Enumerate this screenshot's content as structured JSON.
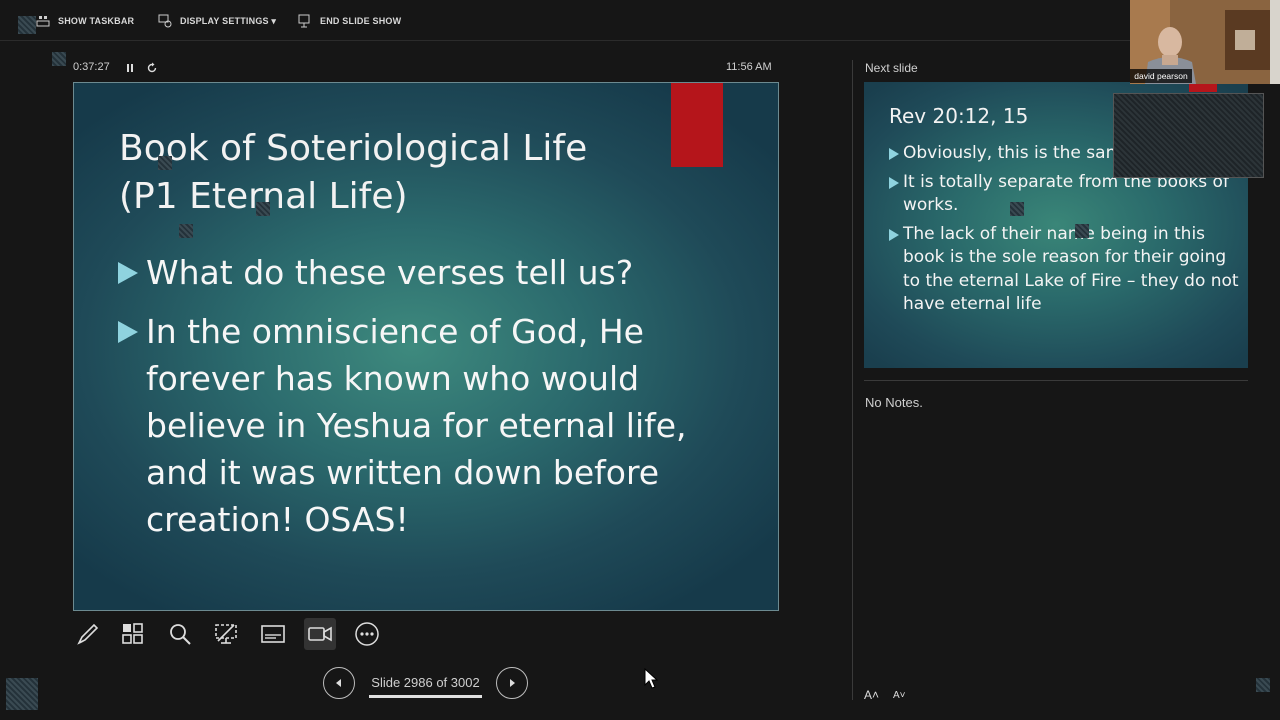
{
  "toolbar": {
    "show_taskbar": "SHOW TASKBAR",
    "display_settings": "DISPLAY SETTINGS ▾",
    "end_slide_show": "END SLIDE SHOW"
  },
  "timer": {
    "elapsed": "0:37:27",
    "clock": "11:56 AM"
  },
  "current_slide": {
    "title_line1": "Book of Soteriological Life",
    "title_line2": "(P1 Eternal Life)",
    "bullets": [
      "What do these verses tell us?",
      "In the omniscience of God, He forever has known who would believe in Yeshua for eternal life, and it was written down before creation! OSAS!"
    ]
  },
  "navigation": {
    "counter": "Slide 2986 of 3002",
    "current": 2986,
    "total": 3002
  },
  "next_panel": {
    "label": "Next slide",
    "title": "Rev 20:12, 15",
    "bullets": [
      "Obviously, this is the same Book of Life.",
      "It is totally separate from the books of works.",
      "The lack of their name being in this book is the sole reason for their going to the eternal Lake of Fire – they do not have eternal life"
    ],
    "notes": "No Notes."
  },
  "webcam": {
    "name": "david pearson"
  },
  "font_controls": {
    "increase": "A˄",
    "decrease": "A˅"
  },
  "colors": {
    "slide_accent_red": "#b5151b",
    "bullet_cyan": "#8fd3df",
    "background": "#161616"
  },
  "icons": [
    "show-taskbar-icon",
    "display-settings-icon",
    "end-show-icon",
    "pause-icon",
    "restart-icon",
    "pen-icon",
    "see-all-slides-icon",
    "zoom-icon",
    "black-screen-icon",
    "subtitles-icon",
    "camera-icon",
    "more-options-icon",
    "previous-icon",
    "next-icon"
  ]
}
